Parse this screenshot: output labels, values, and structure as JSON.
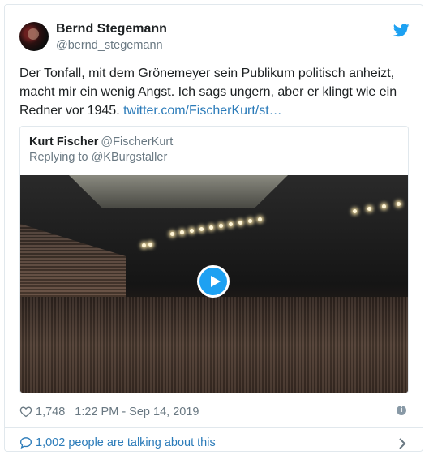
{
  "tweet": {
    "author_name": "Bernd Stegemann",
    "author_handle": "@bernd_stegemann",
    "text": "Der Tonfall, mit dem Grönemeyer sein Publikum politisch anheizt, macht mir ein wenig Angst. Ich sags ungern, aber er klingt wie ein Redner vor 1945. ",
    "link_text": "twitter.com/FischerKurt/st…",
    "likes": "1,748",
    "timestamp": "1:22 PM - Sep 14, 2019",
    "info_glyph": "i",
    "talking": "1,002 people are talking about this"
  },
  "quoted": {
    "author_name": "Kurt Fischer",
    "author_handle": "@FischerKurt",
    "replying_to": "Replying to @KBurgstaller"
  },
  "icons": {
    "bird": "twitter-bird-icon",
    "play": "play-icon",
    "heart": "heart-icon",
    "info": "info-icon",
    "bubble": "speech-bubble-icon",
    "chevron": "chevron-right-icon"
  },
  "colors": {
    "link": "#2b7bb9",
    "brand": "#1da1f2",
    "muted": "#697882"
  }
}
